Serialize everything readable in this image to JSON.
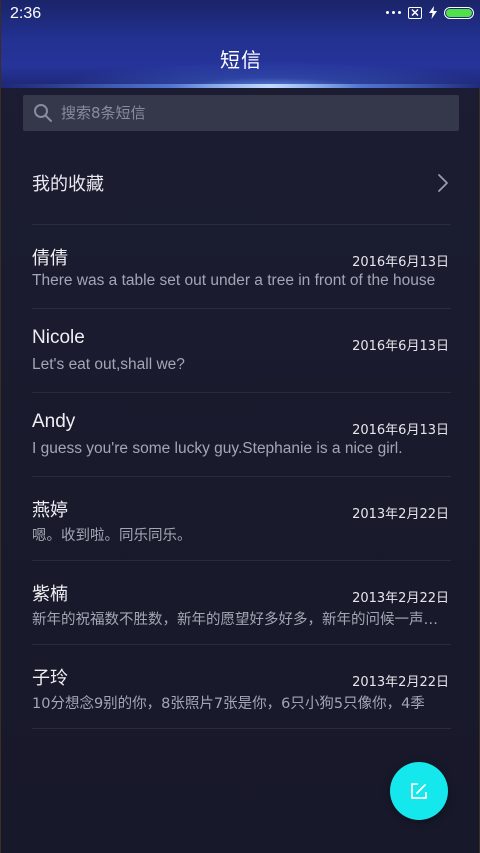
{
  "status_bar": {
    "time": "2:36",
    "battery_color": "#4fe04a"
  },
  "header": {
    "title": "短信"
  },
  "search": {
    "placeholder": "搜索8条短信"
  },
  "favorites": {
    "label": "我的收藏"
  },
  "conversations": [
    {
      "name": "倩倩",
      "date": "2016年6月13日",
      "preview": "There was a table set out under a tree in front of the house"
    },
    {
      "name": "Nicole",
      "date": "2016年6月13日",
      "preview": "Let's eat out,shall we?"
    },
    {
      "name": "Andy",
      "date": "2016年6月13日",
      "preview": "I guess you're some lucky guy.Stephanie is a nice girl."
    },
    {
      "name": "燕婷",
      "date": "2013年2月22日",
      "preview": "嗯。收到啦。同乐同乐。"
    },
    {
      "name": "紫楠",
      "date": "2013年2月22日",
      "preview": "新年的祝福数不胜数，新年的愿望好多好多，新年的问候一声一声"
    },
    {
      "name": "子玲",
      "date": "2013年2月22日",
      "preview": "10分想念9别的你，8张照片7张是你，6只小狗5只像你，4季"
    }
  ],
  "colors": {
    "accent_fab": "#14e8ec",
    "header_blue": "#233191",
    "background": "#1a1b2e"
  },
  "icons": {
    "search": "search-icon",
    "chevron": "chevron-right-icon",
    "compose": "compose-icon"
  }
}
